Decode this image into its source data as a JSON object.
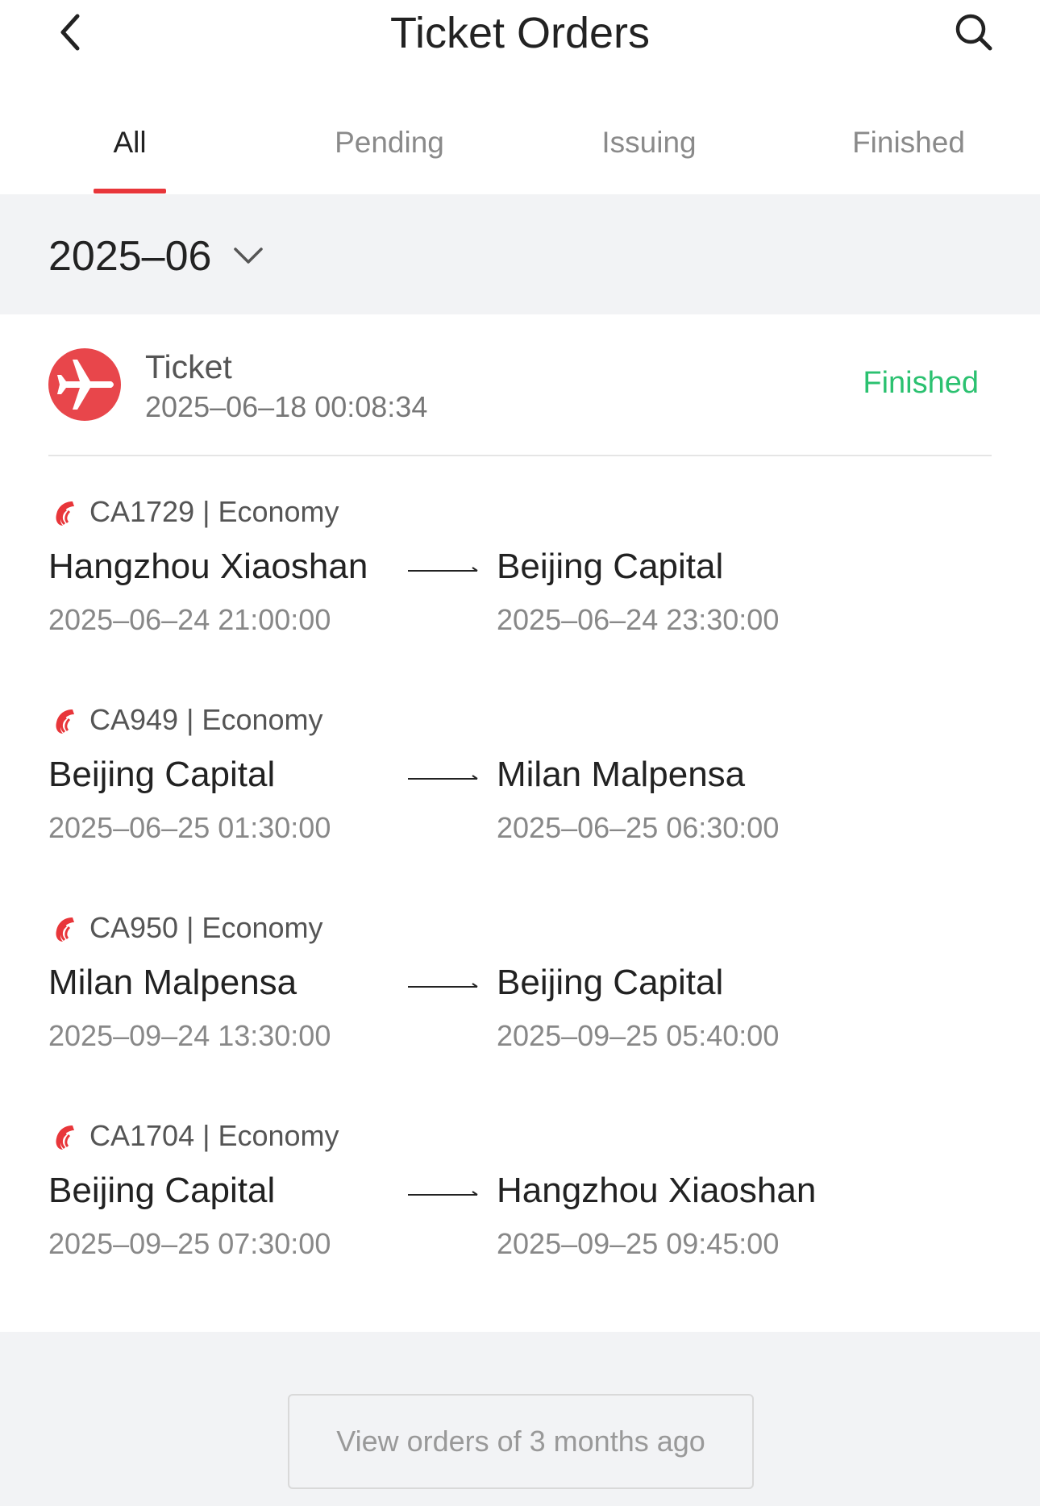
{
  "header": {
    "title": "Ticket Orders",
    "back_icon": "chevron-left-icon",
    "search_icon": "search-icon"
  },
  "tabs": [
    {
      "label": "All",
      "active": true
    },
    {
      "label": "Pending",
      "active": false
    },
    {
      "label": "Issuing",
      "active": false
    },
    {
      "label": "Finished",
      "active": false
    }
  ],
  "month_filter": {
    "value": "2025–06",
    "icon": "chevron-down-icon"
  },
  "order": {
    "icon": "airplane-icon",
    "type": "Ticket",
    "created_at": "2025–06–18 00:08:34",
    "status": "Finished",
    "segments": [
      {
        "flight": "CA1729 | Economy",
        "from": "Hangzhou Xiaoshan",
        "to": "Beijing Capital",
        "depart": "2025–06–24 21:00:00",
        "arrive": "2025–06–24 23:30:00"
      },
      {
        "flight": "CA949 | Economy",
        "from": "Beijing Capital",
        "to": "Milan Malpensa",
        "depart": "2025–06–25 01:30:00",
        "arrive": "2025–06–25 06:30:00"
      },
      {
        "flight": "CA950 | Economy",
        "from": "Milan Malpensa",
        "to": "Beijing Capital",
        "depart": "2025–09–24 13:30:00",
        "arrive": "2025–09–25 05:40:00"
      },
      {
        "flight": "CA1704 | Economy",
        "from": "Beijing Capital",
        "to": "Hangzhou Xiaoshan",
        "depart": "2025–09–25 07:30:00",
        "arrive": "2025–09–25 09:45:00"
      }
    ]
  },
  "older_orders_button": "View orders of 3 months ago",
  "colors": {
    "accent_red": "#e8363a",
    "status_green": "#2bc170",
    "background": "#f2f3f5"
  }
}
